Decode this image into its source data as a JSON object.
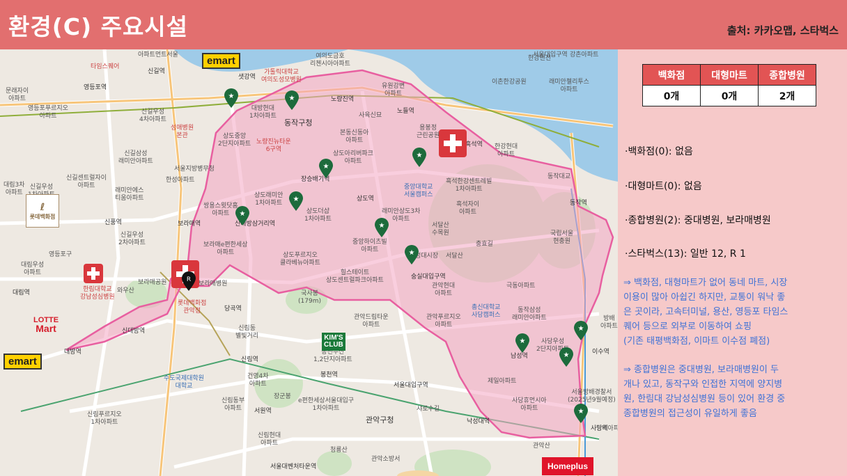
{
  "header": {
    "title": "환경(C) 주요시설",
    "source": "출처: 카카오맵, 스타벅스"
  },
  "counts_table": {
    "headers": [
      "백화점",
      "대형마트",
      "종합병원"
    ],
    "values": [
      "0개",
      "0개",
      "2개"
    ]
  },
  "bullets": [
    "·백화점(0): 없음",
    "·대형마트(0): 없음",
    "·종합병원(2): 중대병원, 보라매병원",
    "·스타벅스(13): 일반 12, R 1"
  ],
  "notes": [
    [
      "⇒ 백화점, 대형마트가 없어 동네 마트, 시장",
      "이용이 많아 아쉽긴 하지만, 교통이 워낙 좋",
      "은 곳이라, 고속터미널, 용산, 영등포 타임스",
      "퀘어 등으로 외부로 이동하여 쇼핑",
      "(기존 태평백화점, 이마트 이수점 폐점)"
    ],
    [
      "⇒ 종합병원은 중대병원, 보라매병원이 두",
      "개나 있고, 동작구와 인접한 지역에 양지병",
      "원, 한림대 강남성심병원 등이 있어 환경 중",
      "종합병원의 접근성이 유일하게 좋음"
    ]
  ],
  "map": {
    "logos": {
      "emart": "emart",
      "homeplus": "Homeplus",
      "lotte_mart": [
        "LOTTE",
        "Mart"
      ],
      "kims_club": [
        "KIM'S",
        "CLUB"
      ],
      "lotte_dept": "롯데백화점",
      "starbucks_r": "R"
    },
    "labels": [
      {
        "t": "신길역",
        "c": "st"
      },
      {
        "t": "영등포역",
        "c": "st"
      },
      {
        "t": "문래자이\n아파트",
        "c": ""
      },
      {
        "t": "영등포푸르지오\n아파트",
        "c": ""
      },
      {
        "t": "신길우성\n4차아파트",
        "c": ""
      },
      {
        "t": "성애병원\n본관",
        "c": "red"
      },
      {
        "t": "신길삼성\n래미안아파트",
        "c": ""
      },
      {
        "t": "신길센트럴자이\n아파트",
        "c": ""
      },
      {
        "t": "래미안에스\n티움아파트",
        "c": ""
      },
      {
        "t": "대림3차\n아파트",
        "c": ""
      },
      {
        "t": "신길우성\n1차아파트",
        "c": ""
      },
      {
        "t": "신풍역",
        "c": "st"
      },
      {
        "t": "신길우성\n2차아파트",
        "c": ""
      },
      {
        "t": "보라매역",
        "c": "st"
      },
      {
        "t": "대림우성\n아파트",
        "c": ""
      },
      {
        "t": "대림역",
        "c": "st"
      },
      {
        "t": "한림대학교\n강남성심병원",
        "c": "red"
      },
      {
        "t": "보라매공원",
        "c": ""
      },
      {
        "t": "보라매병원",
        "c": ""
      },
      {
        "t": "와우산",
        "c": ""
      },
      {
        "t": "신대방역",
        "c": "st"
      },
      {
        "t": "롯데백화점\n관악점",
        "c": "red"
      },
      {
        "t": "당곡역",
        "c": "st"
      },
      {
        "t": "신림동\n별빛거리",
        "c": ""
      },
      {
        "t": "신대방삼거리역",
        "c": "st"
      },
      {
        "t": "상도중앙\n2단지아파트",
        "c": ""
      },
      {
        "t": "노량진뉴타운\n6구역",
        "c": "red"
      },
      {
        "t": "대방현대\n1차아파트",
        "c": ""
      },
      {
        "t": "동작구청",
        "c": "big"
      },
      {
        "t": "가톨릭대학교\n여의도성모병원",
        "c": "red"
      },
      {
        "t": "노량진역",
        "c": "st"
      },
      {
        "t": "샛강역",
        "c": "st"
      },
      {
        "t": "여의도금호\n리첸시아아파트",
        "c": ""
      },
      {
        "t": "유원강변\n아파트",
        "c": ""
      },
      {
        "t": "노들역",
        "c": "st"
      },
      {
        "t": "사육신묘",
        "c": ""
      },
      {
        "t": "본동신동아\n아파트",
        "c": ""
      },
      {
        "t": "상도아리버파크\n아파트",
        "c": ""
      },
      {
        "t": "용봉정\n근린공원",
        "c": ""
      },
      {
        "t": "흑석역",
        "c": "st"
      },
      {
        "t": "한강현대\n아파트",
        "c": ""
      },
      {
        "t": "이촌한강공원",
        "c": ""
      },
      {
        "t": "래미안첼리투스\n아파트",
        "c": ""
      },
      {
        "t": "동작대교",
        "c": ""
      },
      {
        "t": "동작역",
        "c": "st"
      },
      {
        "t": "흑석한강센트레빌\n1차아파트",
        "c": ""
      },
      {
        "t": "흑석자이\n아파트",
        "c": ""
      },
      {
        "t": "중앙대학교\n서울캠퍼스",
        "c": "blue"
      },
      {
        "t": "상도역",
        "c": "st"
      },
      {
        "t": "래미안상도3차\n아파트",
        "c": ""
      },
      {
        "t": "서달산\n수목원",
        "c": ""
      },
      {
        "t": "충효길",
        "c": ""
      },
      {
        "t": "국립서울\n현충원",
        "c": ""
      },
      {
        "t": "서울대입구역",
        "c": ""
      },
      {
        "t": "상도더샵\n1차아파트",
        "c": ""
      },
      {
        "t": "상도래미안\n1차아파트",
        "c": ""
      },
      {
        "t": "쌍용스윗닷홈\n아파트",
        "c": ""
      },
      {
        "t": "장승배기역",
        "c": "st"
      },
      {
        "t": "성대시장",
        "c": ""
      },
      {
        "t": "중앙하이츠빌\n아파트",
        "c": ""
      },
      {
        "t": "서달산",
        "c": ""
      },
      {
        "t": "보라매e편한세상\n아파트",
        "c": ""
      },
      {
        "t": "상도푸르지오\n클라베뉴아파트",
        "c": ""
      },
      {
        "t": "힐스테이트\n상도센트럴파크아파트",
        "c": ""
      },
      {
        "t": "국사봉\n(179m)",
        "c": ""
      },
      {
        "t": "관악현대\n아파트",
        "c": ""
      },
      {
        "t": "극동아파트",
        "c": ""
      },
      {
        "t": "숭실대입구역",
        "c": "st"
      },
      {
        "t": "관악드림타운\n아파트",
        "c": ""
      },
      {
        "t": "관악푸르지오\n아파트",
        "c": ""
      },
      {
        "t": "총신대학교\n사당캠퍼스",
        "c": "blue"
      },
      {
        "t": "동작삼성\n래미안아파트",
        "c": ""
      },
      {
        "t": "사당우성\n2단지아파트",
        "c": ""
      },
      {
        "t": "남성역",
        "c": "st"
      },
      {
        "t": "이수역",
        "c": "st"
      },
      {
        "t": "제일아파트",
        "c": ""
      },
      {
        "t": "사당휴먼시아\n아파트",
        "c": ""
      },
      {
        "t": "사당역",
        "c": "st"
      },
      {
        "t": "서울방배경찰서\n(2025년9월예정)",
        "c": ""
      },
      {
        "t": "방배\n아파트",
        "c": ""
      },
      {
        "t": "봉천두산\n1,2단지아파트",
        "c": ""
      },
      {
        "t": "신림역",
        "c": "st"
      },
      {
        "t": "건영4차\n아파트",
        "c": ""
      },
      {
        "t": "수도국제대학원\n대학교",
        "c": "blue"
      },
      {
        "t": "봉천역",
        "c": "st"
      },
      {
        "t": "장군봉",
        "c": ""
      },
      {
        "t": "e편한세상서울대입구\n1차아파트",
        "c": ""
      },
      {
        "t": "서원역",
        "c": "st"
      },
      {
        "t": "신림동부\n아파트",
        "c": ""
      },
      {
        "t": "관악구청",
        "c": "big"
      },
      {
        "t": "서울대입구역",
        "c": "st"
      },
      {
        "t": "샤로수길",
        "c": ""
      },
      {
        "t": "낙성대역",
        "c": "st"
      },
      {
        "t": "신림푸르지오\n1차아파트",
        "c": ""
      },
      {
        "t": "신림현대\n아파트",
        "c": ""
      },
      {
        "t": "청룡산",
        "c": ""
      },
      {
        "t": "관악소방서",
        "c": ""
      },
      {
        "t": "서울대벤처타운역",
        "c": "st"
      },
      {
        "t": "관악산",
        "c": ""
      },
      {
        "t": "대방역",
        "c": "st"
      },
      {
        "t": "타임스퀘어",
        "c": "red"
      },
      {
        "t": "영등포구",
        "c": ""
      },
      {
        "t": "한성아파트",
        "c": ""
      },
      {
        "t": "서울지방병무청",
        "c": ""
      },
      {
        "t": "강촌아파트",
        "c": ""
      },
      {
        "t": "한강맨션",
        "c": ""
      },
      {
        "t": "아파트먼트서울",
        "c": ""
      },
      {
        "t": "방배아파트",
        "c": ""
      }
    ]
  }
}
